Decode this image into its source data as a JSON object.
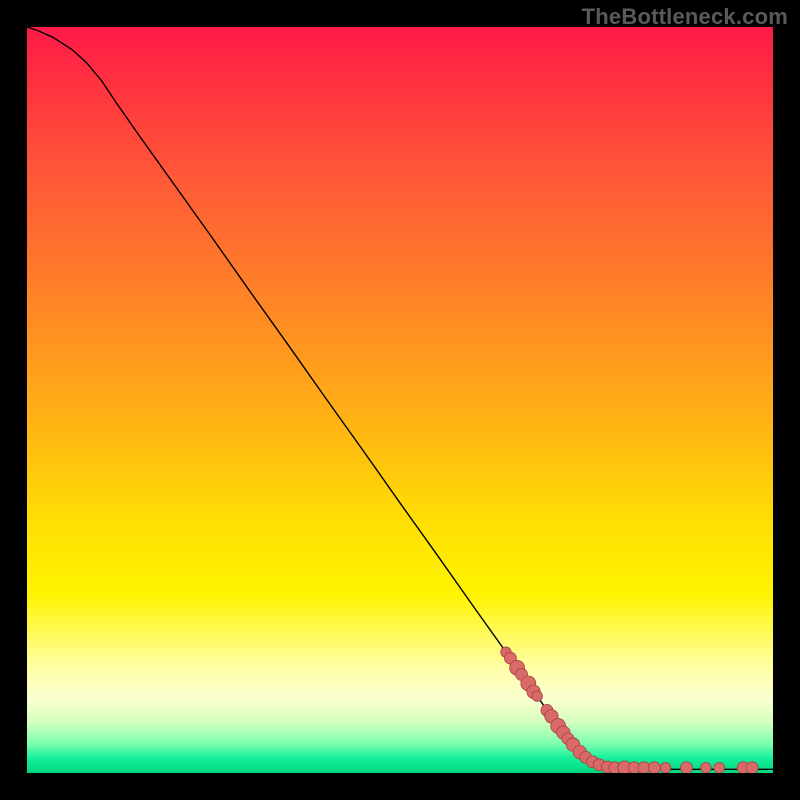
{
  "watermark": "TheBottleneck.com",
  "chart_data": {
    "type": "line",
    "title": "",
    "xlabel": "",
    "ylabel": "",
    "xlim": [
      0,
      100
    ],
    "ylim": [
      0,
      100
    ],
    "grid": false,
    "legend": false,
    "curve": [
      {
        "x": 0.0,
        "y": 100.0
      },
      {
        "x": 1.5,
        "y": 99.5
      },
      {
        "x": 3.5,
        "y": 98.6
      },
      {
        "x": 6.0,
        "y": 97.0
      },
      {
        "x": 8.0,
        "y": 95.2
      },
      {
        "x": 10.0,
        "y": 92.8
      },
      {
        "x": 12.0,
        "y": 89.8
      },
      {
        "x": 15.0,
        "y": 85.5
      },
      {
        "x": 20.0,
        "y": 78.5
      },
      {
        "x": 25.0,
        "y": 71.5
      },
      {
        "x": 30.0,
        "y": 64.4
      },
      {
        "x": 35.0,
        "y": 57.4
      },
      {
        "x": 40.0,
        "y": 50.3
      },
      {
        "x": 45.0,
        "y": 43.3
      },
      {
        "x": 50.0,
        "y": 36.2
      },
      {
        "x": 55.0,
        "y": 29.2
      },
      {
        "x": 60.0,
        "y": 22.1
      },
      {
        "x": 65.0,
        "y": 15.1
      },
      {
        "x": 70.0,
        "y": 8.0
      },
      {
        "x": 72.0,
        "y": 5.2
      },
      {
        "x": 74.0,
        "y": 2.9
      },
      {
        "x": 76.0,
        "y": 1.4
      },
      {
        "x": 78.0,
        "y": 0.7
      },
      {
        "x": 80.0,
        "y": 0.5
      },
      {
        "x": 85.0,
        "y": 0.5
      },
      {
        "x": 90.0,
        "y": 0.5
      },
      {
        "x": 95.0,
        "y": 0.5
      },
      {
        "x": 100.0,
        "y": 0.5
      }
    ],
    "points": [
      {
        "x": 64.2,
        "y": 16.2,
        "r": 0.7
      },
      {
        "x": 64.8,
        "y": 15.4,
        "r": 0.8
      },
      {
        "x": 65.7,
        "y": 14.1,
        "r": 1.0
      },
      {
        "x": 66.3,
        "y": 13.2,
        "r": 0.8
      },
      {
        "x": 67.2,
        "y": 12.0,
        "r": 1.0
      },
      {
        "x": 67.9,
        "y": 10.9,
        "r": 0.9
      },
      {
        "x": 68.4,
        "y": 10.3,
        "r": 0.7
      },
      {
        "x": 69.7,
        "y": 8.4,
        "r": 0.8
      },
      {
        "x": 70.3,
        "y": 7.6,
        "r": 0.9
      },
      {
        "x": 71.2,
        "y": 6.3,
        "r": 1.0
      },
      {
        "x": 71.9,
        "y": 5.4,
        "r": 0.9
      },
      {
        "x": 72.5,
        "y": 4.6,
        "r": 0.8
      },
      {
        "x": 73.2,
        "y": 3.8,
        "r": 0.9
      },
      {
        "x": 74.1,
        "y": 2.8,
        "r": 0.9
      },
      {
        "x": 74.9,
        "y": 2.1,
        "r": 0.8
      },
      {
        "x": 75.8,
        "y": 1.5,
        "r": 0.8
      },
      {
        "x": 76.7,
        "y": 1.1,
        "r": 0.8
      },
      {
        "x": 77.8,
        "y": 0.8,
        "r": 0.8
      },
      {
        "x": 78.8,
        "y": 0.7,
        "r": 0.8
      },
      {
        "x": 80.1,
        "y": 0.7,
        "r": 0.9
      },
      {
        "x": 81.4,
        "y": 0.7,
        "r": 0.8
      },
      {
        "x": 82.7,
        "y": 0.7,
        "r": 0.8
      },
      {
        "x": 84.1,
        "y": 0.7,
        "r": 0.8
      },
      {
        "x": 85.6,
        "y": 0.7,
        "r": 0.7
      },
      {
        "x": 88.4,
        "y": 0.7,
        "r": 0.8
      },
      {
        "x": 91.0,
        "y": 0.7,
        "r": 0.7
      },
      {
        "x": 92.8,
        "y": 0.7,
        "r": 0.7
      },
      {
        "x": 96.0,
        "y": 0.7,
        "r": 0.8
      },
      {
        "x": 97.2,
        "y": 0.7,
        "r": 0.8
      }
    ]
  }
}
